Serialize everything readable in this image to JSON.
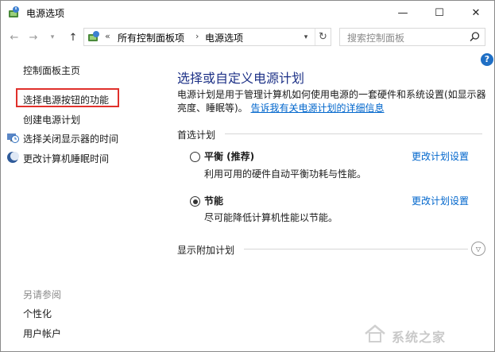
{
  "window": {
    "title": "电源选项",
    "minimize_glyph": "—",
    "maximize_glyph": "☐",
    "close_glyph": "✕"
  },
  "nav": {
    "back_glyph": "←",
    "forward_glyph": "→",
    "recent_glyph": "▾",
    "up_glyph": "↑"
  },
  "address": {
    "overflow": "«",
    "crumbs": [
      "所有控制面板项",
      "电源选项"
    ],
    "separator": "›",
    "dropdown_glyph": "▾",
    "refresh_glyph": "↻"
  },
  "search": {
    "placeholder": "搜索控制面板"
  },
  "help": {
    "label": "?"
  },
  "sidebar": {
    "home": "控制面板主页",
    "items": [
      {
        "label": "选择电源按钮的功能",
        "icon": "none"
      },
      {
        "label": "创建电源计划",
        "icon": "none"
      },
      {
        "label": "选择关闭显示器的时间",
        "icon": "monitor-clock-icon"
      },
      {
        "label": "更改计算机睡眠时间",
        "icon": "moon-icon"
      }
    ],
    "see_also": {
      "heading": "另请参阅",
      "items": [
        "个性化",
        "用户帐户"
      ]
    }
  },
  "main": {
    "title": "选择或自定义电源计划",
    "description": "电源计划是用于管理计算机如何使用电源的一套硬件和系统设置(如显示器亮度、睡眠等)。",
    "description_link": "告诉我有关电源计划的详细信息",
    "preferred_heading": "首选计划",
    "plans": [
      {
        "name": "平衡 (推荐)",
        "description": "利用可用的硬件自动平衡功耗与性能。",
        "selected": false,
        "link": "更改计划设置"
      },
      {
        "name": "节能",
        "description": "尽可能降低计算机性能以节能。",
        "selected": true,
        "link": "更改计划设置"
      }
    ],
    "additional_heading": "显示附加计划",
    "expand_glyph": "▽"
  },
  "watermark": {
    "text": "系统之家"
  },
  "colors": {
    "title_blue": "#1e3287",
    "link_blue": "#0066cc",
    "highlight_red": "#e0302b",
    "help_blue": "#1f6fc5"
  }
}
